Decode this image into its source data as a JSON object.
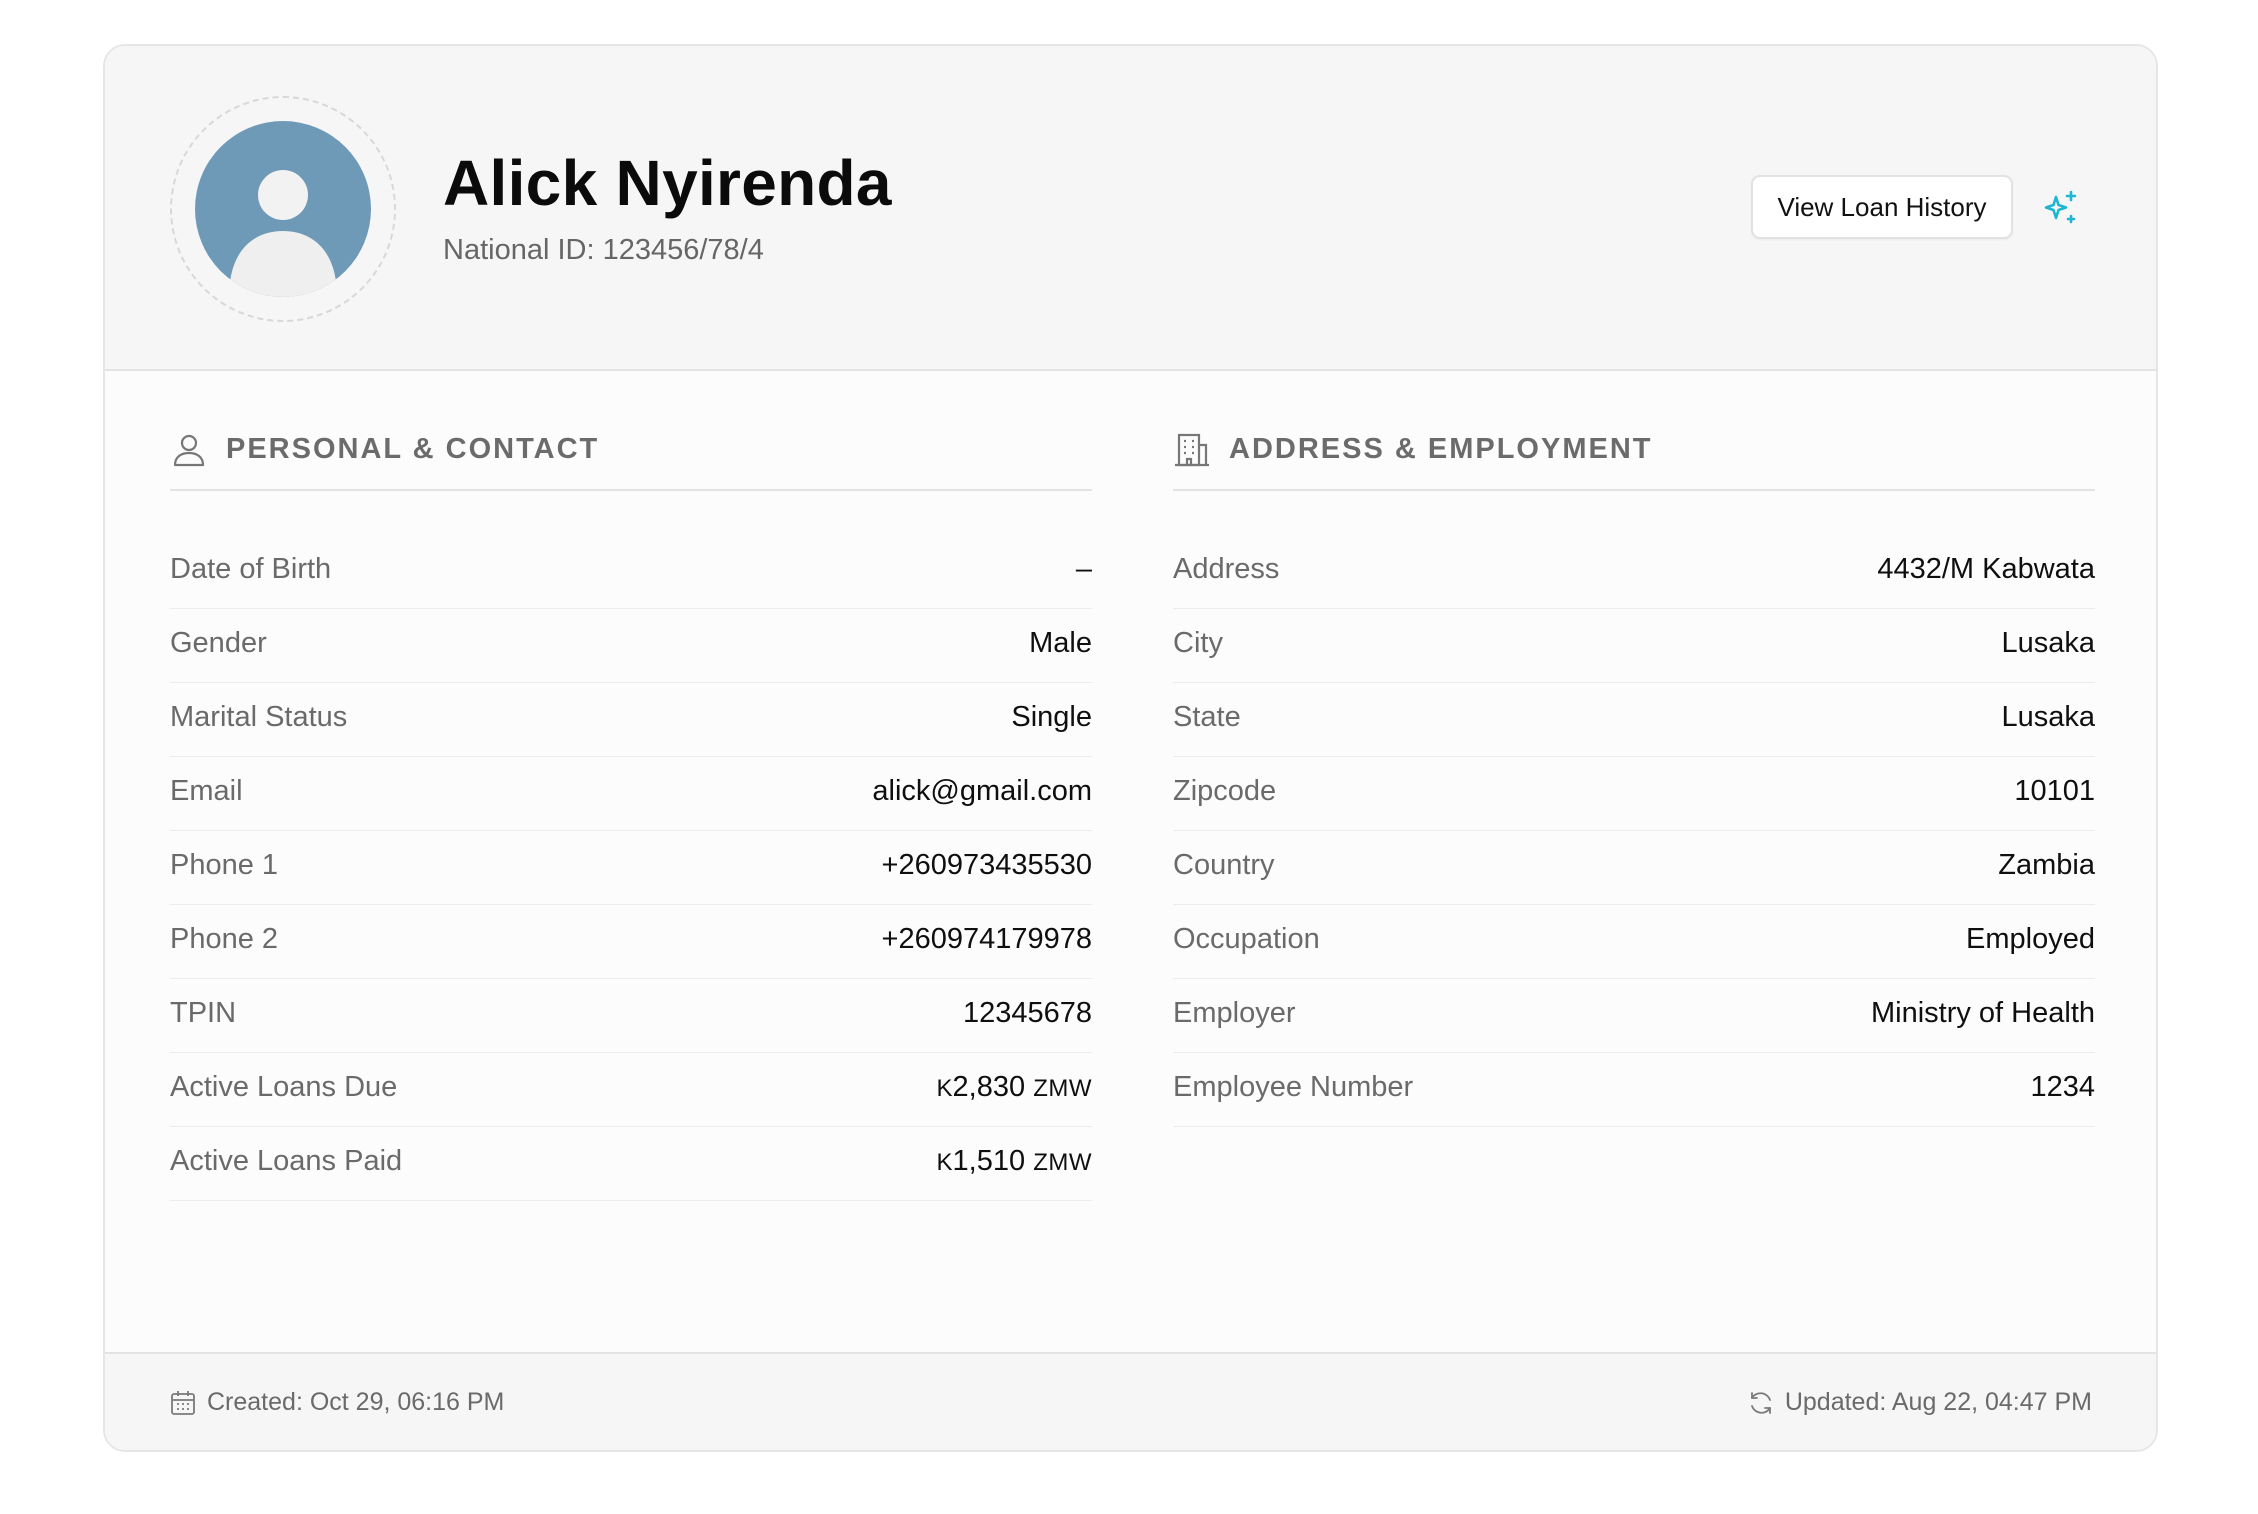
{
  "profile": {
    "name": "Alick Nyirenda",
    "national_id": "National ID: 123456/78/4",
    "view_history_label": "View Loan History",
    "avatar_color": "#6e9ab8",
    "sparkle_color": "#1eb6d2"
  },
  "personal": {
    "title": "PERSONAL & CONTACT",
    "icon": "user-icon",
    "rows": [
      {
        "label": "Date of Birth",
        "value": "–"
      },
      {
        "label": "Gender",
        "value": "Male"
      },
      {
        "label": "Marital Status",
        "value": "Single"
      },
      {
        "label": "Email",
        "value": "alick@gmail.com"
      },
      {
        "label": "Phone 1",
        "value": "+260973435530"
      },
      {
        "label": "Phone 2",
        "value": "+260974179978"
      },
      {
        "label": "TPIN",
        "value": "12345678"
      },
      {
        "label": "Active Loans Due",
        "currency": "K",
        "value": "2,830",
        "unit": "ZMW"
      },
      {
        "label": "Active Loans Paid",
        "currency": "K",
        "value": "1,510",
        "unit": "ZMW"
      }
    ]
  },
  "address": {
    "title": "ADDRESS & EMPLOYMENT",
    "icon": "building-icon",
    "rows": [
      {
        "label": "Address",
        "value": "4432/M Kabwata"
      },
      {
        "label": "City",
        "value": "Lusaka"
      },
      {
        "label": "State",
        "value": "Lusaka"
      },
      {
        "label": "Zipcode",
        "value": "10101"
      },
      {
        "label": "Country",
        "value": "Zambia"
      },
      {
        "label": "Occupation",
        "value": "Employed"
      },
      {
        "label": "Employer",
        "value": "Ministry of Health"
      },
      {
        "label": "Employee Number",
        "value": "1234"
      }
    ]
  },
  "footer": {
    "created": "Created: Oct 29, 06:16 PM",
    "updated": "Updated: Aug 22, 04:47 PM"
  }
}
